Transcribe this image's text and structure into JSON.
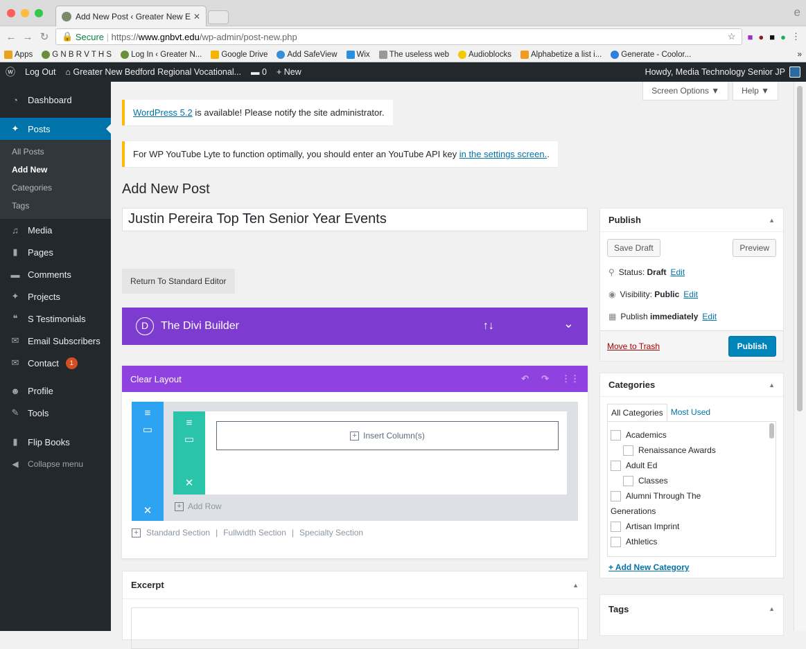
{
  "browser": {
    "tab_title": "Add New Post ‹ Greater New E",
    "secure_label": "Secure",
    "url_scheme": "https://",
    "url_domain": "www.gnbvt.edu",
    "url_path": "/wp-admin/post-new.php",
    "bookmarks": [
      {
        "label": "Apps",
        "color": "#e8a21b"
      },
      {
        "label": "G N B R V T H S",
        "color": "#6b8e3d"
      },
      {
        "label": "Log In ‹ Greater N...",
        "color": "#6b8e3d"
      },
      {
        "label": "Google Drive",
        "color": "#f4b400"
      },
      {
        "label": "Add SafeView",
        "color": "#3a8dd8"
      },
      {
        "label": "Wix",
        "color": "#2b8fe0"
      },
      {
        "label": "The useless web",
        "color": "#777777"
      },
      {
        "label": "Audioblocks",
        "color": "#f5c800"
      },
      {
        "label": "Alphabetize a list i...",
        "color": "#f29b1d"
      },
      {
        "label": "Generate - Coolor...",
        "color": "#2d7fe0"
      }
    ],
    "bookmark_overflow": "»"
  },
  "adminbar": {
    "logout": "Log Out",
    "site_name": "Greater New Bedford Regional Vocational...",
    "comments_count": "0",
    "new_label": "New",
    "howdy": "Howdy, Media Technology Senior JP"
  },
  "sidebar": {
    "dashboard": "Dashboard",
    "posts": "Posts",
    "posts_sub": [
      "All Posts",
      "Add New",
      "Categories",
      "Tags"
    ],
    "media": "Media",
    "pages": "Pages",
    "comments": "Comments",
    "projects": "Projects",
    "testimonials": "S Testimonials",
    "email_subscribers": "Email Subscribers",
    "contact": "Contact",
    "contact_badge": "1",
    "profile": "Profile",
    "tools": "Tools",
    "flip_books": "Flip Books",
    "collapse": "Collapse menu"
  },
  "screen_options": "Screen Options ▼",
  "help": "Help ▼",
  "notice1": {
    "link": "WordPress 5.2",
    "text": " is available! Please notify the site administrator."
  },
  "notice2": {
    "text": "For WP YouTube Lyte to function optimally, you should enter an YouTube API key ",
    "link": "in the settings screen.",
    "tail": "."
  },
  "page_title": "Add New Post",
  "post_title_value": "Justin Pereira Top Ten Senior Year Events",
  "return_button": "Return To Standard Editor",
  "divi": {
    "logo": "D",
    "title": "The Divi Builder",
    "sort_icon": "↑↓",
    "collapse_icon": "⌄"
  },
  "builder": {
    "clear_layout": "Clear Layout",
    "insert_columns": "Insert Column(s)",
    "add_row": "Add Row",
    "standard_section": "Standard Section",
    "fullwidth_section": "Fullwidth Section",
    "specialty_section": "Specialty Section",
    "separator": "|"
  },
  "excerpt_title": "Excerpt",
  "publish": {
    "title": "Publish",
    "save_draft": "Save Draft",
    "preview": "Preview",
    "status_label": "Status: ",
    "status_value": "Draft",
    "visibility_label": "Visibility: ",
    "visibility_value": "Public",
    "publish_label": "Publish ",
    "publish_value": "immediately",
    "edit": "Edit",
    "trash": "Move to Trash",
    "publish_button": "Publish"
  },
  "categories": {
    "title": "Categories",
    "tab_all": "All Categories",
    "tab_used": "Most Used",
    "items": [
      {
        "label": "Academics",
        "indent": false
      },
      {
        "label": "Renaissance Awards",
        "indent": true
      },
      {
        "label": "Adult Ed",
        "indent": false
      },
      {
        "label": "Classes",
        "indent": true
      },
      {
        "label": "Alumni Through The",
        "indent": false
      },
      {
        "label": "Generations",
        "indent": false,
        "continuation": true
      },
      {
        "label": "Artisan Imprint",
        "indent": false
      },
      {
        "label": "Athletics",
        "indent": false
      }
    ],
    "add_new": "+ Add New Category"
  },
  "tags_title": "Tags",
  "colors": {
    "wp_blue": "#0073aa",
    "divi_purple": "#7e3bd0",
    "divi_section": "#2ea3f2",
    "divi_row": "#29c4a9",
    "admin_dark": "#23282d"
  }
}
